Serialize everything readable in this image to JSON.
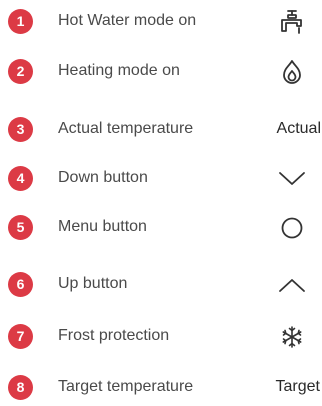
{
  "accent_color": "#dc3a45",
  "items": [
    {
      "number": "1",
      "label": "Hot Water mode on",
      "icon": "tap-icon"
    },
    {
      "number": "2",
      "label": "Heating mode on",
      "icon": "flame-icon"
    },
    {
      "number": "3",
      "label": "Actual temperature",
      "icon_text": "Actual"
    },
    {
      "number": "4",
      "label": "Down button",
      "icon": "chevron-down-icon"
    },
    {
      "number": "5",
      "label": "Menu button",
      "icon": "circle-icon"
    },
    {
      "number": "6",
      "label": "Up button",
      "icon": "chevron-up-icon"
    },
    {
      "number": "7",
      "label": "Frost protection",
      "icon": "snowflake-icon"
    },
    {
      "number": "8",
      "label": "Target temperature",
      "icon_text": "Target"
    }
  ]
}
